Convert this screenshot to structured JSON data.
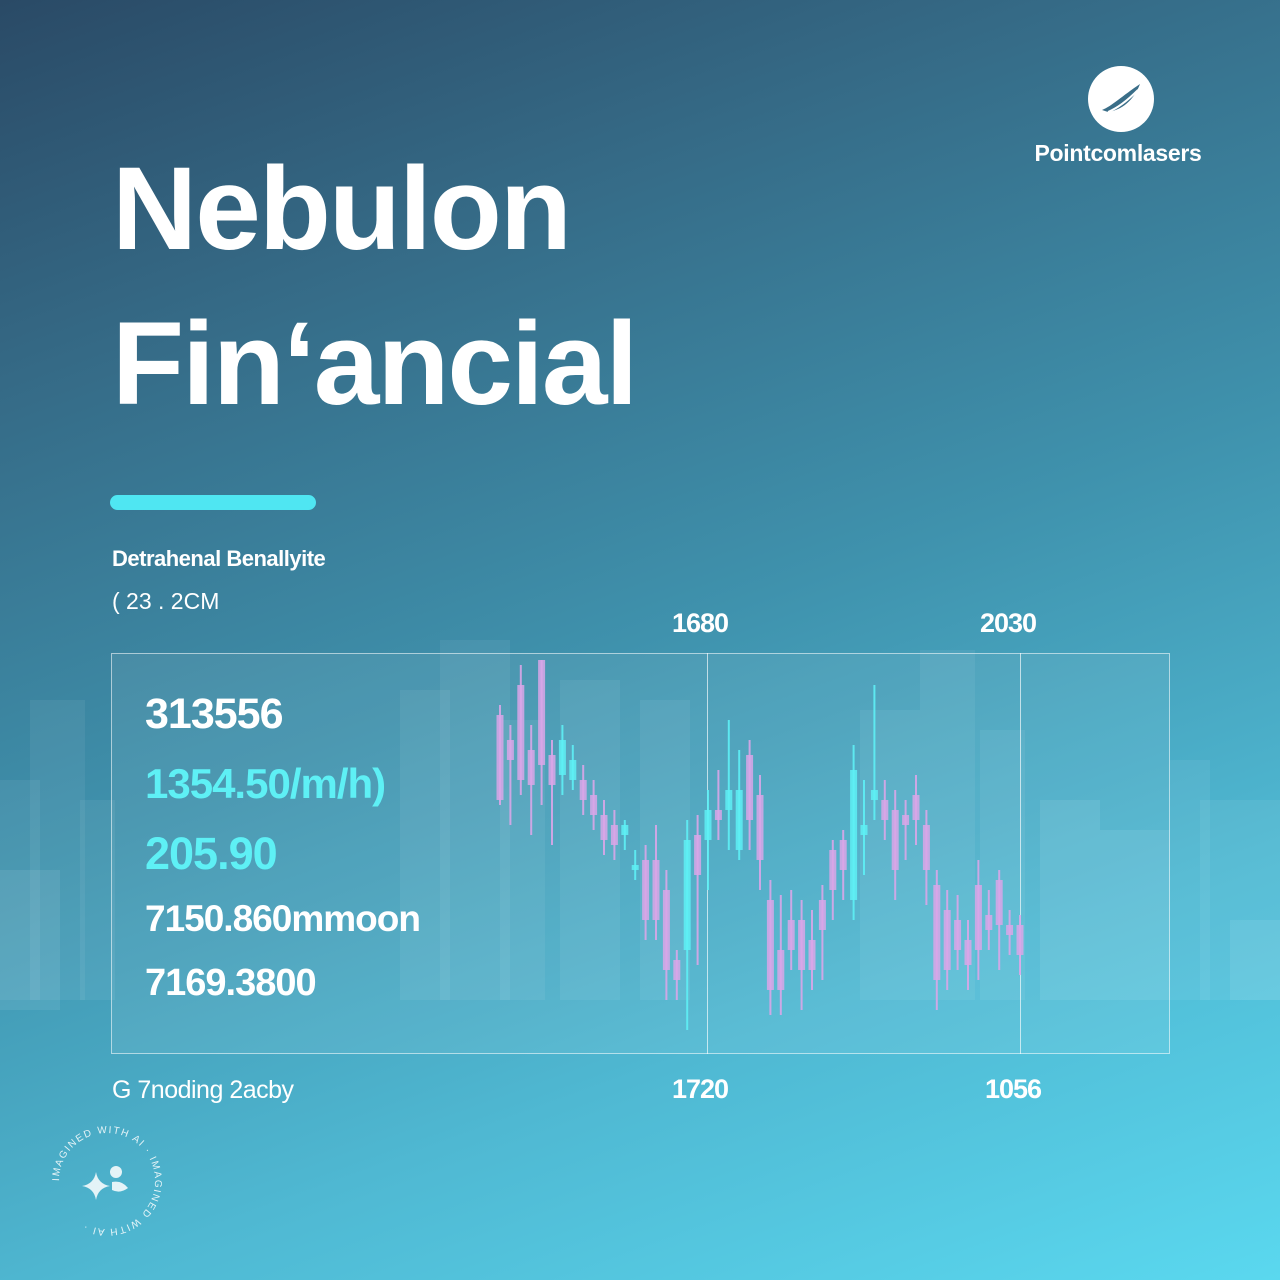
{
  "brand": {
    "name": "Pointcomlasers",
    "logo_icon": "leaf-logo-icon"
  },
  "title": {
    "line1": "Nebulon",
    "line2": "Finʻancial"
  },
  "subtitle": {
    "label": "Detrahenal Benallyite",
    "value": "( 23 . 2CM"
  },
  "years": {
    "top_mid": "1680",
    "top_right": "2030",
    "bottom_mid": "1720",
    "bottom_right": "1056"
  },
  "stats": [
    {
      "value": "313556",
      "color": "#ffffff"
    },
    {
      "value": "1354.50/m/h)",
      "color": "#5ef0f5"
    },
    {
      "value": "205.90",
      "color": "#5ef0f5"
    },
    {
      "value": "7150.860mmoon",
      "color": "#ffffff"
    },
    {
      "value": "7169.3800",
      "color": "#ffffff"
    }
  ],
  "footer": {
    "label": "G 7noding 2acby"
  },
  "badge": {
    "text": "IMAGINED WITH AI · IMAGINED WITH AI ·",
    "icon": "sparkle-icon"
  },
  "colors": {
    "candle_up": "#5ef0f5",
    "candle_down": "#d9a6e8",
    "accent": "#4fe6f2"
  },
  "chart_data": {
    "type": "candlestick",
    "series": [
      {
        "o": 0.29,
        "c": 0.12,
        "h": 0.31,
        "l": 0.11
      },
      {
        "o": 0.24,
        "c": 0.2,
        "h": 0.27,
        "l": 0.07
      },
      {
        "o": 0.35,
        "c": 0.16,
        "h": 0.39,
        "l": 0.13
      },
      {
        "o": 0.22,
        "c": 0.15,
        "h": 0.27,
        "l": 0.05
      },
      {
        "o": 0.4,
        "c": 0.19,
        "h": 0.4,
        "l": 0.11
      },
      {
        "o": 0.21,
        "c": 0.15,
        "h": 0.24,
        "l": 0.03
      },
      {
        "o": 0.17,
        "c": 0.24,
        "h": 0.27,
        "l": 0.13
      },
      {
        "o": 0.16,
        "c": 0.2,
        "h": 0.23,
        "l": 0.14
      },
      {
        "o": 0.16,
        "c": 0.12,
        "h": 0.19,
        "l": 0.09
      },
      {
        "o": 0.13,
        "c": 0.09,
        "h": 0.16,
        "l": 0.06
      },
      {
        "o": 0.09,
        "c": 0.04,
        "h": 0.12,
        "l": 0.01
      },
      {
        "o": 0.07,
        "c": 0.03,
        "h": 0.1,
        "l": 0.0
      },
      {
        "o": 0.05,
        "c": 0.07,
        "h": 0.08,
        "l": 0.02
      },
      {
        "o": -0.02,
        "c": -0.01,
        "h": 0.02,
        "l": -0.04
      },
      {
        "o": 0.0,
        "c": -0.12,
        "h": 0.03,
        "l": -0.16
      },
      {
        "o": 0.0,
        "c": -0.12,
        "h": 0.07,
        "l": -0.16
      },
      {
        "o": -0.06,
        "c": -0.22,
        "h": -0.02,
        "l": -0.28
      },
      {
        "o": -0.2,
        "c": -0.24,
        "h": -0.18,
        "l": -0.28
      },
      {
        "o": -0.18,
        "c": 0.04,
        "h": 0.08,
        "l": -0.34
      },
      {
        "o": 0.05,
        "c": -0.03,
        "h": 0.09,
        "l": -0.21
      },
      {
        "o": 0.04,
        "c": 0.1,
        "h": 0.14,
        "l": -0.06
      },
      {
        "o": 0.1,
        "c": 0.08,
        "h": 0.18,
        "l": 0.04
      },
      {
        "o": 0.1,
        "c": 0.14,
        "h": 0.28,
        "l": 0.02
      },
      {
        "o": 0.02,
        "c": 0.14,
        "h": 0.22,
        "l": 0.0
      },
      {
        "o": 0.21,
        "c": 0.08,
        "h": 0.24,
        "l": 0.02
      },
      {
        "o": 0.13,
        "c": 0.0,
        "h": 0.17,
        "l": -0.06
      },
      {
        "o": -0.08,
        "c": -0.26,
        "h": -0.04,
        "l": -0.31
      },
      {
        "o": -0.18,
        "c": -0.26,
        "h": -0.07,
        "l": -0.31
      },
      {
        "o": -0.12,
        "c": -0.18,
        "h": -0.06,
        "l": -0.22
      },
      {
        "o": -0.12,
        "c": -0.22,
        "h": -0.08,
        "l": -0.3
      },
      {
        "o": -0.16,
        "c": -0.22,
        "h": -0.1,
        "l": -0.26
      },
      {
        "o": -0.08,
        "c": -0.14,
        "h": -0.05,
        "l": -0.24
      },
      {
        "o": 0.02,
        "c": -0.06,
        "h": 0.04,
        "l": -0.12
      },
      {
        "o": 0.04,
        "c": -0.02,
        "h": 0.06,
        "l": -0.08
      },
      {
        "o": -0.08,
        "c": 0.18,
        "h": 0.23,
        "l": -0.12
      },
      {
        "o": 0.05,
        "c": 0.07,
        "h": 0.16,
        "l": -0.03
      },
      {
        "o": 0.12,
        "c": 0.14,
        "h": 0.35,
        "l": 0.08
      },
      {
        "o": 0.12,
        "c": 0.08,
        "h": 0.16,
        "l": 0.04
      },
      {
        "o": 0.1,
        "c": -0.02,
        "h": 0.14,
        "l": -0.08
      },
      {
        "o": 0.09,
        "c": 0.07,
        "h": 0.12,
        "l": 0.0
      },
      {
        "o": 0.13,
        "c": 0.08,
        "h": 0.17,
        "l": 0.03
      },
      {
        "o": 0.07,
        "c": -0.02,
        "h": 0.1,
        "l": -0.09
      },
      {
        "o": -0.05,
        "c": -0.24,
        "h": -0.02,
        "l": -0.3
      },
      {
        "o": -0.1,
        "c": -0.22,
        "h": -0.06,
        "l": -0.26
      },
      {
        "o": -0.12,
        "c": -0.18,
        "h": -0.07,
        "l": -0.22
      },
      {
        "o": -0.16,
        "c": -0.21,
        "h": -0.12,
        "l": -0.26
      },
      {
        "o": -0.05,
        "c": -0.18,
        "h": 0.0,
        "l": -0.24
      },
      {
        "o": -0.11,
        "c": -0.14,
        "h": -0.06,
        "l": -0.18
      },
      {
        "o": -0.04,
        "c": -0.13,
        "h": -0.02,
        "l": -0.22
      },
      {
        "o": -0.13,
        "c": -0.15,
        "h": -0.1,
        "l": -0.19
      },
      {
        "o": -0.13,
        "c": -0.19,
        "h": -0.11,
        "l": -0.23
      }
    ]
  }
}
